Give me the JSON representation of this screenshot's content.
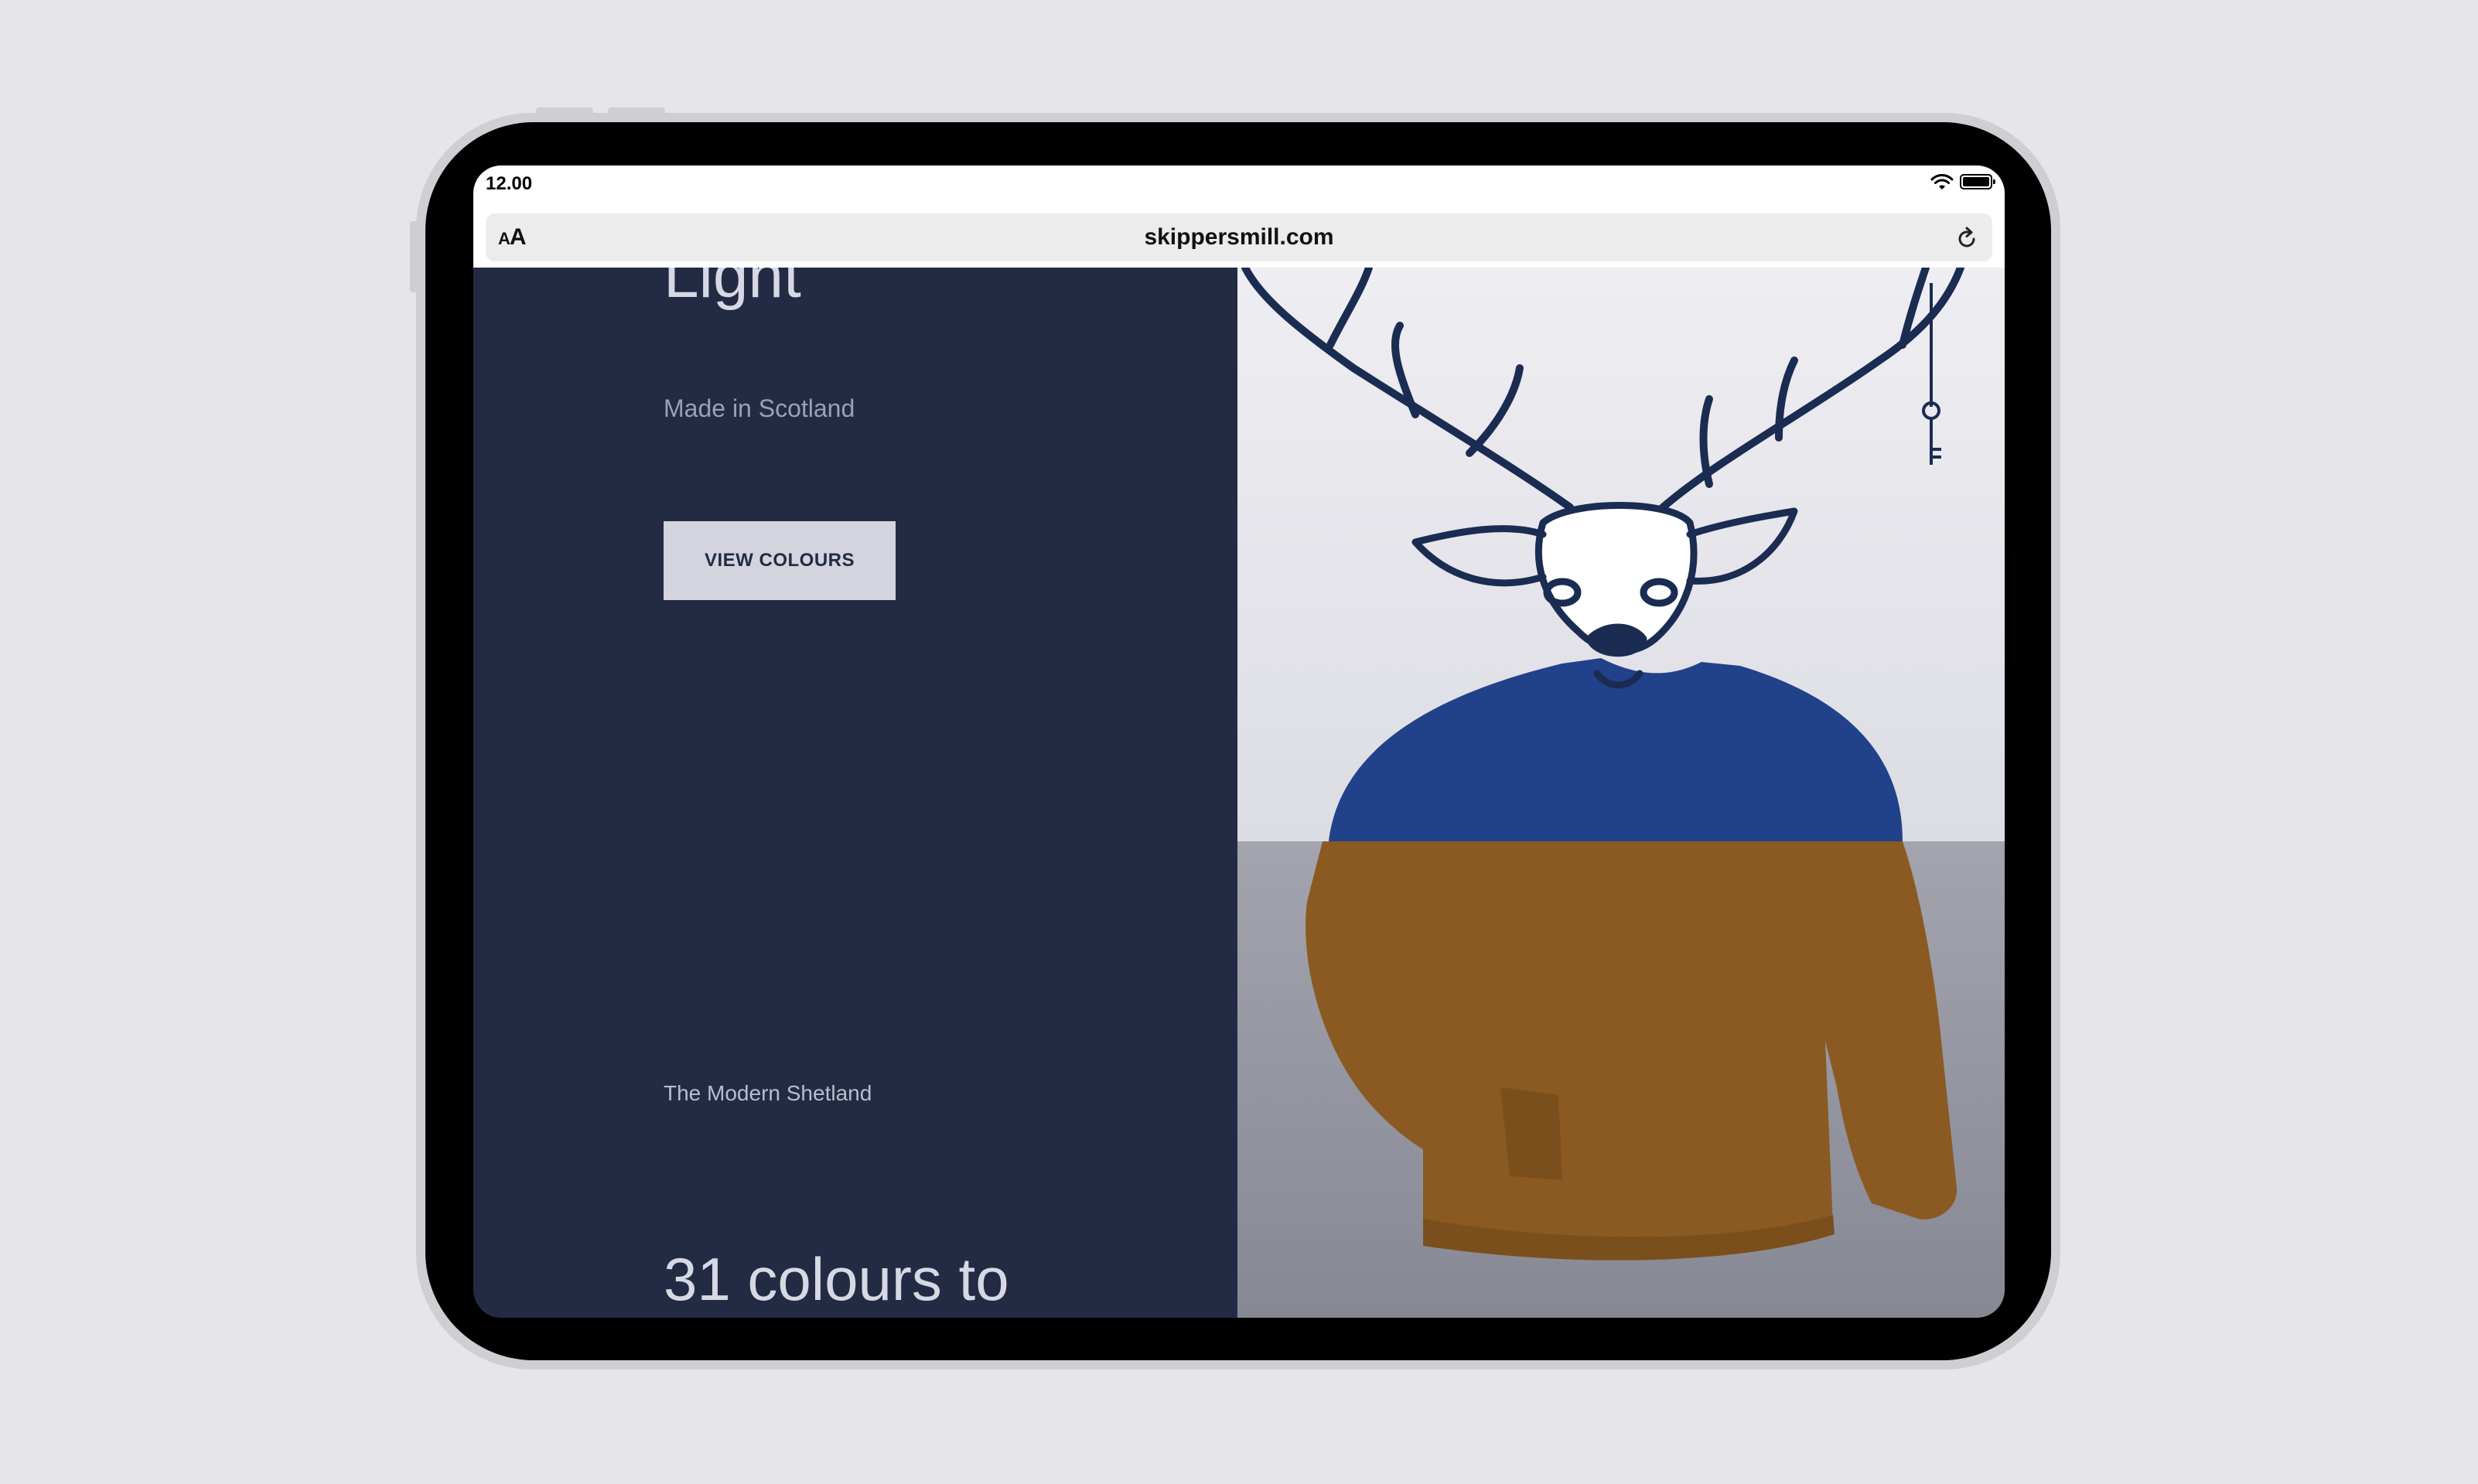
{
  "status_bar": {
    "time": "12.00"
  },
  "browser": {
    "text_size_label": "AA",
    "url": "skippersmill.com"
  },
  "page": {
    "hero_title": "Light",
    "subtitle": "Made in Scotland",
    "cta_label": "VIEW COLOURS",
    "section_label": "The Modern Shetland",
    "big_heading": "31 colours to"
  },
  "icons": {
    "wifi": "wifi-icon",
    "battery": "battery-icon",
    "reload": "reload-icon"
  },
  "colors": {
    "panel_navy": "#232b44",
    "button_bg": "#d3d4de",
    "sweater_blue": "#21428a",
    "sweater_brown": "#8a5a22",
    "ink": "#1b2c52"
  }
}
